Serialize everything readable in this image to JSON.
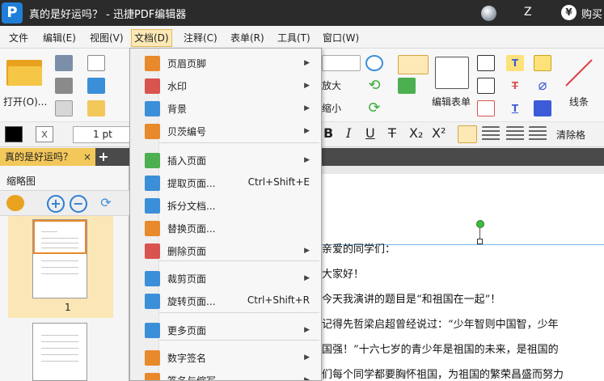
{
  "titlebar": {
    "logo_glyph": "P",
    "title": "真的是好运吗？ - 迅捷PDF编辑器",
    "user_initial": "Z",
    "yen_glyph": "¥",
    "buy_label": "购买"
  },
  "menubar": {
    "items": [
      "文件",
      "编辑(E)",
      "视图(V)",
      "文档(D)",
      "注释(C)",
      "表单(R)",
      "工具(T)",
      "窗口(W)"
    ],
    "active": "文档(D)"
  },
  "toolbar": {
    "open_label": "打开(O)...",
    "zoom_in_label": "放大",
    "zoom_out_label": "缩小",
    "edit_form_label": "编辑表单",
    "line_label": "线条",
    "clear_format_label": "清除格"
  },
  "format": {
    "line_width": "1 pt",
    "font_buttons": [
      "B",
      "I",
      "U",
      "T",
      "X₂",
      "X²"
    ]
  },
  "tabs": {
    "doc_tab": "真的是好运吗？",
    "close_glyph": "×",
    "add_glyph": "+"
  },
  "thumbnails": {
    "title": "缩略图",
    "page_label": "1"
  },
  "document": {
    "lines": [
      "亲爱的同学们：",
      "大家好！",
      "今天我演讲的题目是“和祖国在一起”！",
      "记得先哲梁启超曾经说过：“少年智则中国智，少年",
      "国强！”十六七岁的青少年是祖国的未来，是祖国的",
      "们每个同学都要胸怀祖国，为祖国的繁荣昌盛而努力"
    ]
  },
  "dropdown": {
    "items": [
      {
        "label": "页眉页脚",
        "submenu": true,
        "icon": "header-footer-icon",
        "color": "#e8892b"
      },
      {
        "label": "水印",
        "submenu": true,
        "icon": "watermark-icon",
        "color": "#d9534f"
      },
      {
        "label": "背景",
        "submenu": true,
        "icon": "background-icon",
        "color": "#3b8fd8"
      },
      {
        "label": "贝茨编号",
        "submenu": true,
        "icon": "bates-number-icon",
        "color": "#e8892b"
      },
      {
        "label": "插入页面",
        "submenu": true,
        "icon": "insert-page-icon",
        "color": "#4caf50"
      },
      {
        "label": "提取页面...",
        "shortcut": "Ctrl+Shift+E",
        "icon": "extract-page-icon",
        "color": "#3b8fd8"
      },
      {
        "label": "拆分文档...",
        "icon": "split-doc-icon",
        "color": "#3b8fd8"
      },
      {
        "label": "替换页面...",
        "icon": "replace-page-icon",
        "color": "#e8892b"
      },
      {
        "label": "删除页面",
        "submenu": true,
        "icon": "delete-page-icon",
        "color": "#d9534f"
      },
      {
        "label": "裁剪页面",
        "submenu": true,
        "icon": "crop-page-icon",
        "color": "#3b8fd8"
      },
      {
        "label": "旋转页面...",
        "shortcut": "Ctrl+Shift+R",
        "icon": "rotate-page-icon",
        "color": "#3b8fd8"
      },
      {
        "label": "更多页面",
        "submenu": true,
        "icon": "more-pages-icon",
        "color": "#3b8fd8"
      },
      {
        "label": "数字签名",
        "submenu": true,
        "icon": "digital-signature-icon",
        "color": "#e8892b"
      },
      {
        "label": "签名与缩写",
        "submenu": true,
        "icon": "sign-initials-icon",
        "color": "#e8892b"
      }
    ],
    "arrow_glyph": "▶"
  }
}
